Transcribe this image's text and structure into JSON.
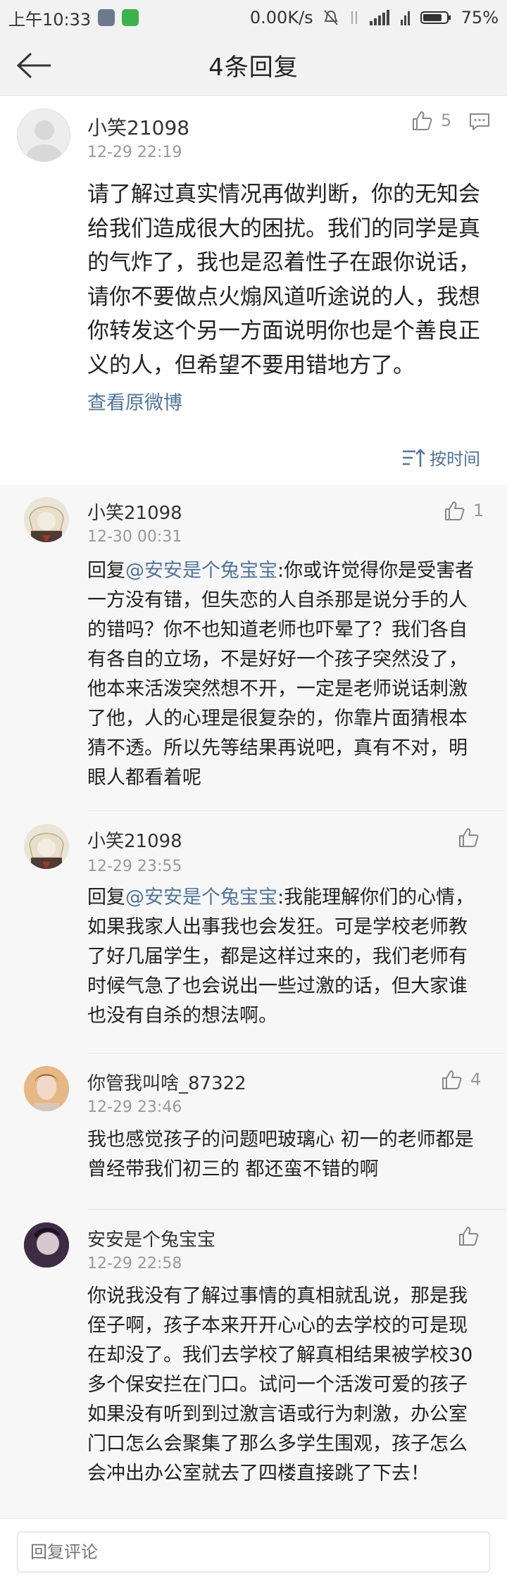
{
  "status_bar": {
    "time": "上午10:33",
    "network_speed": "0.00K/s",
    "signal_label": "4G\n1X",
    "battery_percent": "75%"
  },
  "nav": {
    "title": "4条回复",
    "back_icon": "arrow-left-icon"
  },
  "main_post": {
    "author": "小笑21098",
    "time": "12-29 22:19",
    "likes": "5",
    "text": "请了解过真实情况再做判断，你的无知会给我们造成很大的困扰。我们的同学是真的气炸了，我也是忍着性子在跟你说话，请你不要做点火煽风道听途说的人，我想你转发这个另一方面说明你也是个善良正义的人，但希望不要用错地方了。",
    "view_original": "查看原微博",
    "sort_label": "按时间"
  },
  "replies": [
    {
      "author": "小笑21098",
      "time": "12-30 00:31",
      "likes": "1",
      "reply_prefix": "回复",
      "mention": "@安安是个兔宝宝",
      "text": ":你或许觉得你是受害者一方没有错，但失恋的人自杀那是说分手的人的错吗？你不也知道老师也吓晕了？我们各自有各自的立场，不是好好一个孩子突然没了，他本来活泼突然想不开，一定是老师说话刺激了他，人的心理是很复杂的，你靠片面猜根本猜不透。所以先等结果再说吧，真有不对，明眼人都看着呢"
    },
    {
      "author": "小笑21098",
      "time": "12-29 23:55",
      "likes": "",
      "reply_prefix": "回复",
      "mention": "@安安是个兔宝宝",
      "text": ":我能理解你们的心情，如果我家人出事我也会发狂。可是学校老师教了好几届学生，都是这样过来的，我们老师有时候气急了也会说出一些过激的话，但大家谁也没有自杀的想法啊。"
    },
    {
      "author": "你管我叫啥_87322",
      "time": "12-29 23:46",
      "likes": "4",
      "text": "我也感觉孩子的问题吧玻璃心  初一的老师都是曾经带我们初三的 都还蛮不错的啊"
    },
    {
      "author": "安安是个兔宝宝",
      "time": "12-29 22:58",
      "likes": "",
      "text": "你说我没有了解过事情的真相就乱说，那是我侄子啊，孩子本来开开心心的去学校的可是现在却没了。我们去学校了解真相结果被学校30多个保安拦在门口。试问一个活泼可爱的孩子如果没有听到到过激言语或行为刺激，办公室门口怎么会聚集了那么多学生围观，孩子怎么会冲出办公室就去了四楼直接跳了下去！"
    }
  ],
  "bottom": {
    "reply_placeholder": "回复评论"
  },
  "colors": {
    "link": "#52749a",
    "background": "#f7f7f7",
    "header": "#f2f2f2"
  }
}
